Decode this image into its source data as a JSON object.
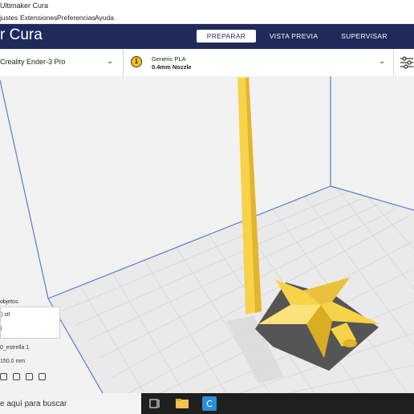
{
  "window": {
    "title": "Ultimaker Cura"
  },
  "menu": [
    "justes",
    "Extensiones",
    "Preferencias",
    "Ayuda"
  ],
  "header": {
    "logo": "r Cura",
    "stages": [
      "PREPARAR",
      "VISTA PREVIA",
      "SUPERVISAR"
    ],
    "active_stage": "PREPARAR"
  },
  "printer": {
    "name": "Creality Ender-3 Pro"
  },
  "material": {
    "extruder": "1",
    "name": "Generic PLA",
    "nozzle": "0.4mm Nozzle",
    "color": "#f5c518"
  },
  "objects": {
    "title": "objetos",
    "list": [
      ").stl",
      "l"
    ],
    "selected_name": "0_estrella 1",
    "dimensions": "150.0 mm"
  },
  "taskbar": {
    "search_placeholder": "e aquí para buscar"
  },
  "colors": {
    "header": "#1f2a5a",
    "model": "#f7d34a",
    "build_plate": "#e9e9e9",
    "volume_edges": "#5b7bd8"
  },
  "icons": [
    "settings-sliders-icon",
    "chevron-down-icon",
    "task-view-icon",
    "file-explorer-icon",
    "cura-app-icon",
    "object-view-icons"
  ]
}
